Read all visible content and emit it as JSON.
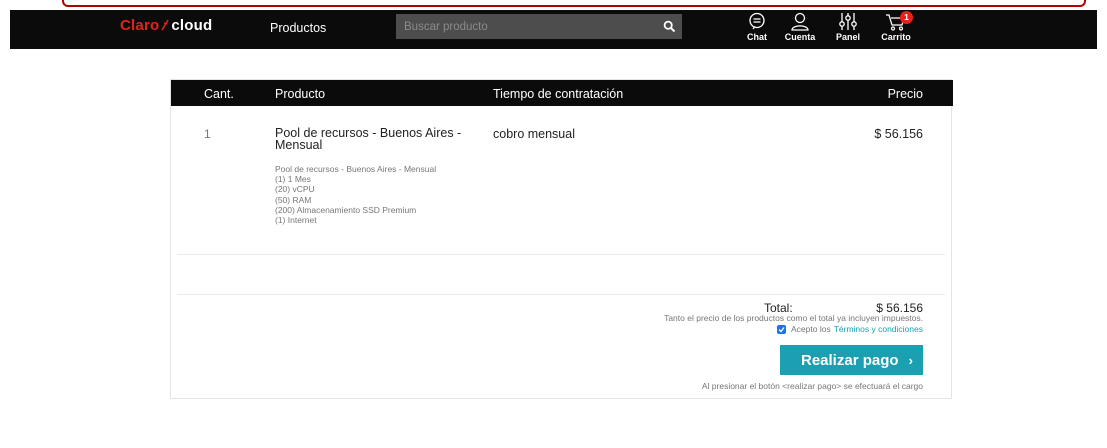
{
  "navbar": {
    "logo": {
      "part1": "Claro",
      "part2": "cloud"
    },
    "products_label": "Productos",
    "search_placeholder": "Buscar producto",
    "items": [
      {
        "icon": "chat-icon",
        "label": "Chat"
      },
      {
        "icon": "user-icon",
        "label": "Cuenta"
      },
      {
        "icon": "sliders-icon",
        "label": "Panel"
      },
      {
        "icon": "cart-icon",
        "label": "Carrito",
        "badge": "1"
      }
    ]
  },
  "table": {
    "headers": {
      "qty": "Cant.",
      "product": "Producto",
      "time": "Tiempo de contratación",
      "price": "Precio"
    },
    "row": {
      "qty": "1",
      "product_name": "Pool de recursos - Buenos Aires - Mensual",
      "details": [
        "Pool de recursos - Buenos Aires - Mensual",
        "(1) 1 Mes",
        "(20) vCPU",
        "(50) RAM",
        "(200) Almacenamiento SSD Premium",
        "(1) Internet"
      ],
      "time": "cobro mensual",
      "price": "$ 56.156"
    }
  },
  "summary": {
    "total_label": "Total:",
    "total_value": "$ 56.156",
    "tax_note": "Tanto el precio de los productos como el total ya incluyen impuestos.",
    "terms_prefix": "Acepto los",
    "terms_link": "Términos y condiciones",
    "terms_checked": true,
    "pay_button": "Realizar pago",
    "pay_note": "Al presionar el botón <realizar pago> se efectuará el cargo"
  },
  "colors": {
    "brand_red": "#e2231a",
    "accent_teal": "#1aa0b0",
    "navbar_bg": "#0b0b0b"
  }
}
